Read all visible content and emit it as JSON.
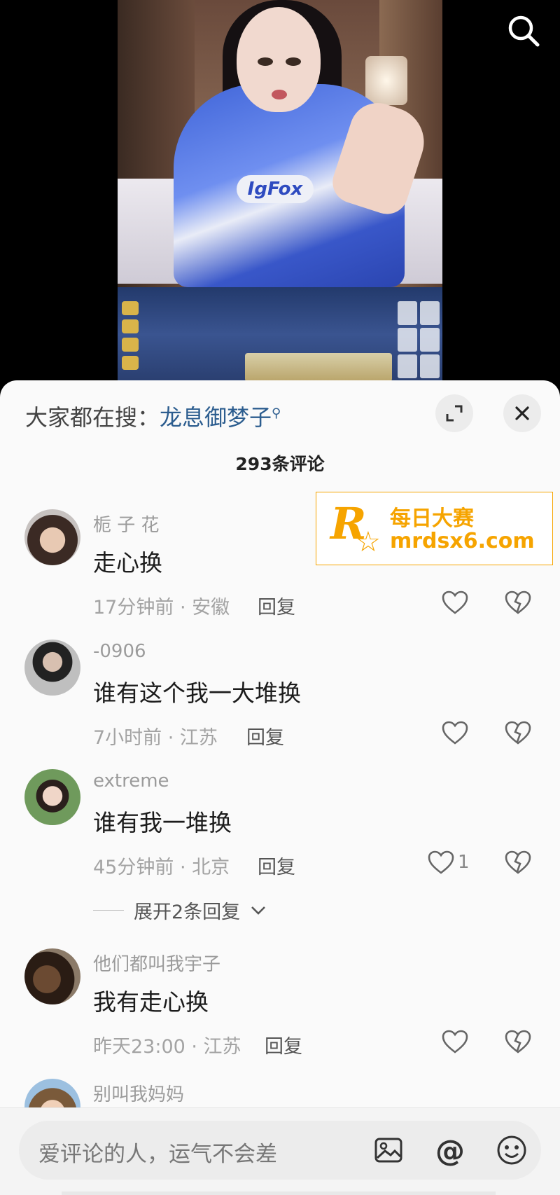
{
  "search_hint": {
    "prefix": "大家都在搜：",
    "keyword": "龙息御梦子"
  },
  "comment_count": "293条评论",
  "comments": [
    {
      "username": "栀 子 花",
      "text": "走心换",
      "meta": "17分钟前 · 安徽",
      "reply": "回复",
      "likes": ""
    },
    {
      "username": "-0906",
      "text": "谁有这个我一大堆换",
      "meta": "7小时前 · 江苏",
      "reply": "回复",
      "likes": ""
    },
    {
      "username": "extreme",
      "text": "谁有我一堆换",
      "meta": "45分钟前 · 北京",
      "reply": "回复",
      "likes": "1"
    },
    {
      "username": "他们都叫我宇子",
      "text": "我有走心换",
      "meta": "昨天23:00 · 江苏",
      "reply": "回复",
      "likes": ""
    },
    {
      "username": "别叫我妈妈",
      "text": "",
      "meta": "",
      "reply": "",
      "likes": ""
    }
  ],
  "expand_replies": "展开2条回复",
  "watermark": {
    "letter": "R",
    "name": "每日大赛",
    "url": "mrdsx6.com"
  },
  "input": {
    "placeholder": "爱评论的人，运气不会差"
  },
  "colors": {
    "keyword": "#2c5d8f",
    "watermark": "#f6a400",
    "panel_bg": "#fafafa"
  },
  "icons": [
    "search-icon",
    "expand-icon",
    "close-icon",
    "heart-icon",
    "broken-heart-icon",
    "image-icon",
    "at-icon",
    "emoji-icon",
    "chevron-down-icon"
  ]
}
